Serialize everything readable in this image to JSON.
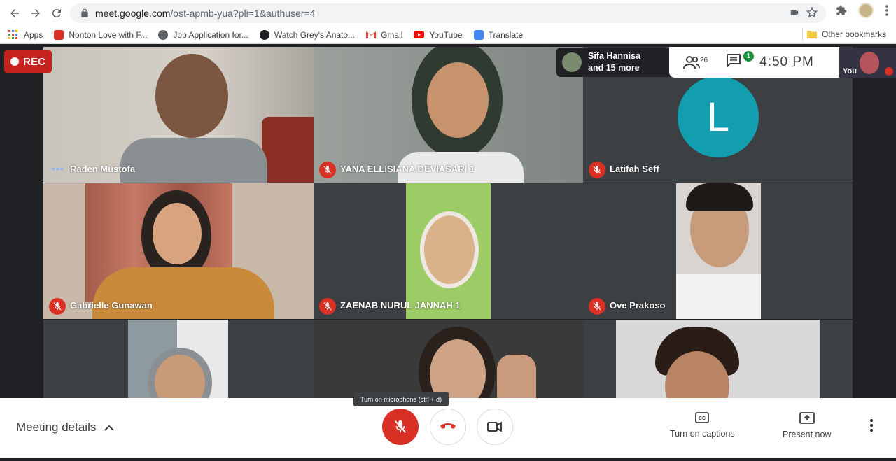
{
  "browser": {
    "url_host": "meet.google.com",
    "url_path": "/ost-apmb-yua?pli=1&authuser=4",
    "bookmarks": [
      {
        "label": "Apps",
        "color": "#4285f4"
      },
      {
        "label": "Nonton Love with F...",
        "color": "#d93025"
      },
      {
        "label": "Job Application for...",
        "color": "#5f6368"
      },
      {
        "label": "Watch Grey's Anato...",
        "color": "#202124"
      },
      {
        "label": "Gmail",
        "color": "#ea4335"
      },
      {
        "label": "YouTube",
        "color": "#ff0000"
      },
      {
        "label": "Translate",
        "color": "#4285f4"
      }
    ],
    "other_bookmarks": "Other bookmarks"
  },
  "meet": {
    "rec_label": "REC",
    "others": {
      "line1": "Sifa Hannisa",
      "line2": "and 15 more"
    },
    "participants_count": "26",
    "chat_badge": "1",
    "time": "4:50  PM",
    "self_label": "You",
    "tiles": [
      {
        "name": "Raden Mustofa",
        "muted": false,
        "bg": "#b9b5ae"
      },
      {
        "name": "YANA ELLISIANA DEVIASARI 1",
        "muted": true,
        "bg": "#8f9590"
      },
      {
        "name": "Latifah Seff",
        "muted": true,
        "bg": "#3c4043",
        "initial": "L"
      },
      {
        "name": "Gabrielle Gunawan",
        "muted": true,
        "bg": "#c9b9a8"
      },
      {
        "name": "ZAENAB NURUL JANNAH 1",
        "muted": true,
        "bg": "#9ccc65"
      },
      {
        "name": "Ove Prakoso",
        "muted": true,
        "bg": "#d9d4cf"
      },
      {
        "name": "",
        "muted": false,
        "bg": "#8d9aa0"
      },
      {
        "name": "",
        "muted": false,
        "bg": "#3a3a3a"
      },
      {
        "name": "",
        "muted": false,
        "bg": "#d8d8d8"
      }
    ]
  },
  "bottom": {
    "meeting_details": "Meeting details",
    "tooltip": "Turn on microphone (ctrl + d)",
    "captions": "Turn on captions",
    "present": "Present now"
  }
}
